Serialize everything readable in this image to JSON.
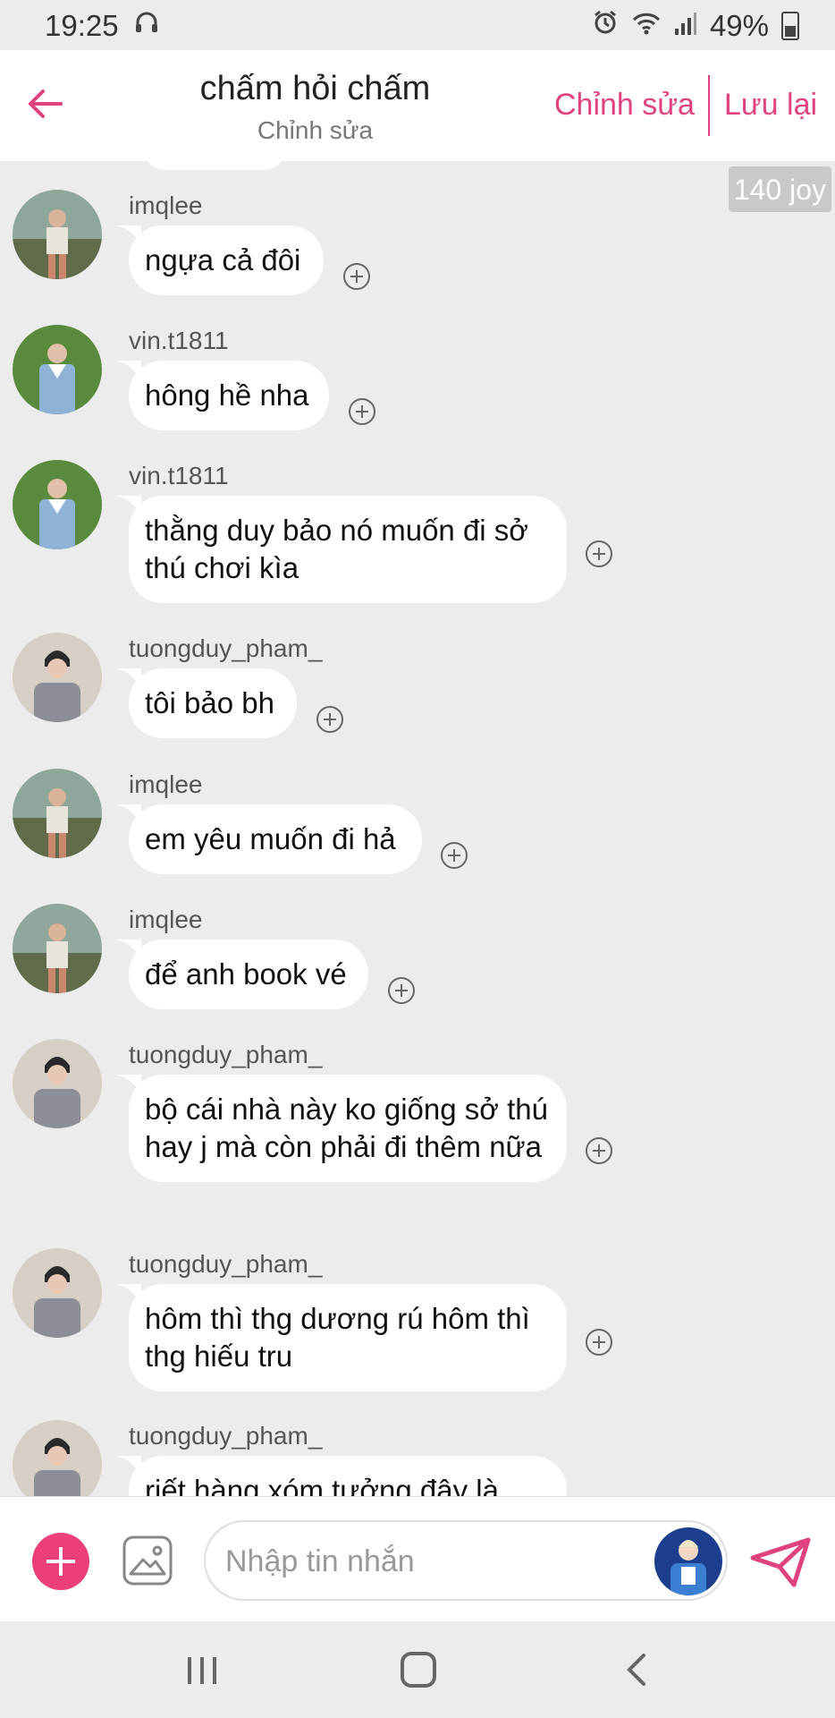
{
  "status_bar": {
    "time": "19:25",
    "battery": "49%"
  },
  "header": {
    "title": "chấm hỏi chấm",
    "subtitle": "Chỉnh sửa",
    "edit_label": "Chỉnh sửa",
    "save_label": "Lưu lại"
  },
  "joy_badge": "140 joy",
  "messages": [
    {
      "user": "imqlee",
      "text": "ngựa cả đôi"
    },
    {
      "user": "vin.t1811",
      "text": "hông hề nha"
    },
    {
      "user": "vin.t1811",
      "text": "thằng duy bảo nó muốn đi sở thú chơi kìa"
    },
    {
      "user": "tuongduy_pham_",
      "text": "tôi bảo bh"
    },
    {
      "user": "imqlee",
      "text": "em yêu muốn đi hả"
    },
    {
      "user": "imqlee",
      "text": "để anh book vé"
    },
    {
      "user": "tuongduy_pham_",
      "text": "bộ cái nhà này ko giống sở thú hay j mà còn phải đi thêm nữa"
    },
    {
      "user": "tuongduy_pham_",
      "text": "hôm thì thg dương rú hôm thì thg hiếu tru"
    },
    {
      "user": "tuongduy_pham_",
      "text": "riết hàng xóm tưởng đây là"
    }
  ],
  "composer": {
    "placeholder": "Nhập tin nhắn"
  },
  "colors": {
    "accent": "#e0427f",
    "add_button": "#ec3f78",
    "background": "#ececec",
    "bubble": "#ffffff"
  }
}
